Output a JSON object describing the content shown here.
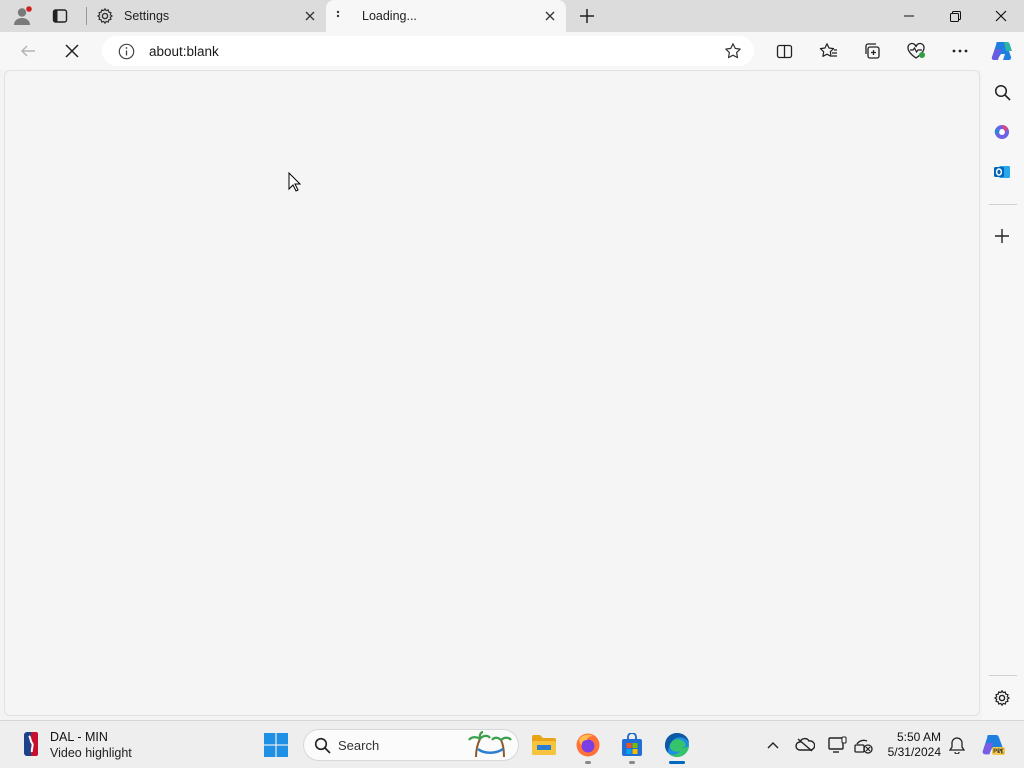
{
  "browser": {
    "tabs": [
      {
        "label": "Settings",
        "icon": "gear-icon",
        "active": false
      },
      {
        "label": "Loading...",
        "icon": "loading-icon",
        "active": true
      }
    ],
    "address": {
      "url": "about:blank",
      "info_icon": "info-icon"
    },
    "window_buttons": [
      "minimize-icon",
      "restore-icon",
      "close-icon"
    ],
    "toolbar_icons": [
      "back-icon",
      "stop-icon",
      "favorite-star-icon",
      "split-screen-icon",
      "favorites-icon",
      "collections-icon",
      "browser-essentials-icon",
      "more-icon",
      "copilot-icon"
    ],
    "sidebar_icons": [
      "search-icon",
      "copilot-apps-icon",
      "outlook-icon",
      "add-icon",
      "settings-icon"
    ]
  },
  "taskbar": {
    "news": {
      "title": "DAL - MIN",
      "subtitle": "Video highlight",
      "icon": "nba-icon"
    },
    "search_placeholder": "Search",
    "apps": [
      "start-icon",
      "file-explorer-icon",
      "firefox-icon",
      "store-icon",
      "edge-icon"
    ],
    "tray": [
      "chevron-up-icon",
      "onedrive-offline-icon",
      "display-icon",
      "network-icon",
      "notification-icon",
      "copilot-pre-icon"
    ],
    "clock": {
      "time": "5:50 AM",
      "date": "5/31/2024"
    }
  },
  "colors": {
    "accent": "#0067c0",
    "titlebar": "#dcdcdc",
    "content": "#f5f5f5"
  }
}
